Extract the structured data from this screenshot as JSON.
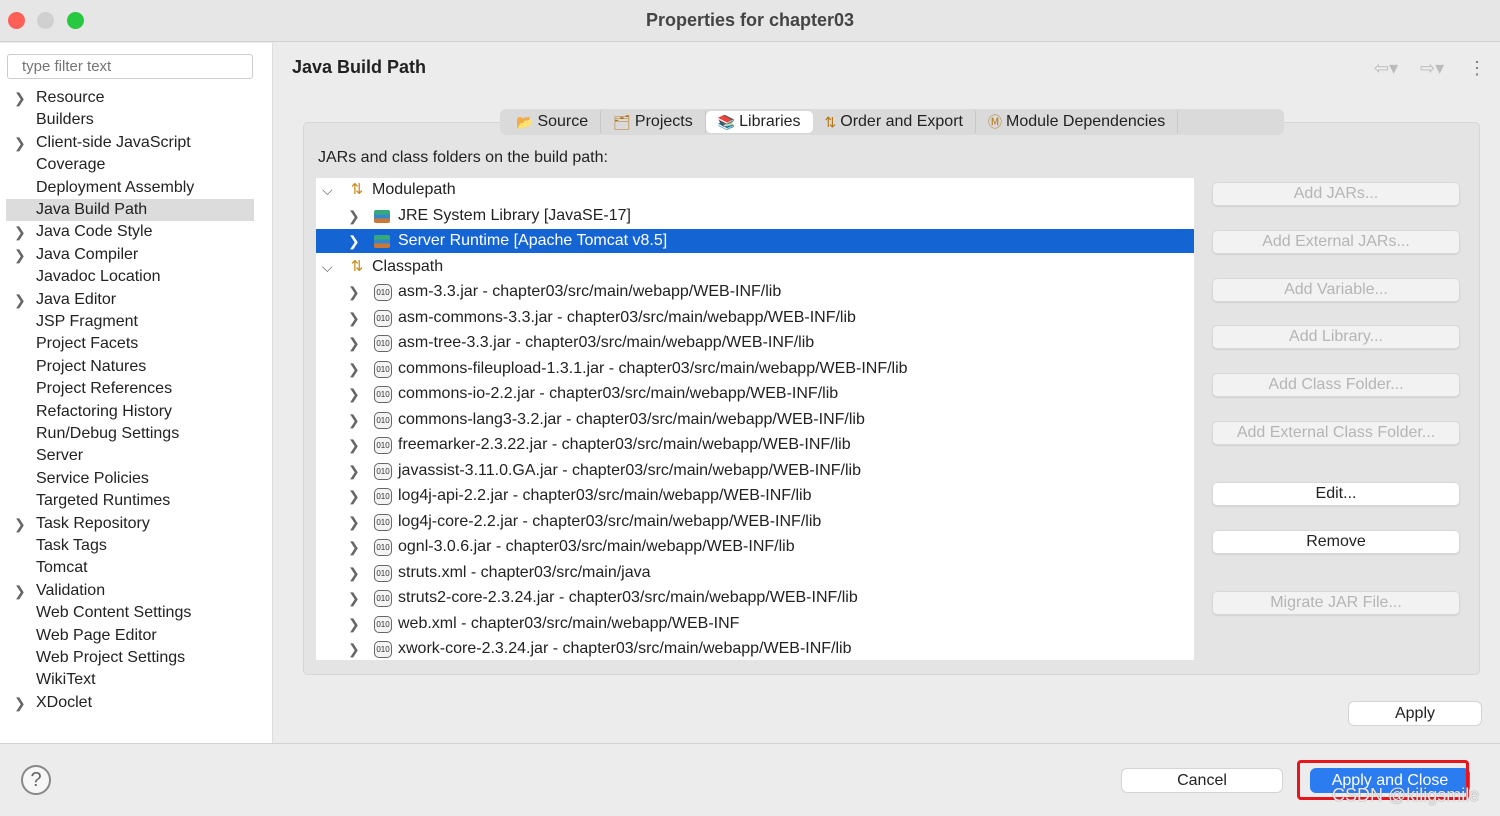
{
  "window": {
    "title": "Properties for chapter03"
  },
  "sidebar": {
    "filter_placeholder": "type filter text",
    "items": [
      {
        "label": "Resource",
        "expandable": true
      },
      {
        "label": "Builders"
      },
      {
        "label": "Client-side JavaScript",
        "expandable": true
      },
      {
        "label": "Coverage"
      },
      {
        "label": "Deployment Assembly"
      },
      {
        "label": "Java Build Path",
        "selected": true
      },
      {
        "label": "Java Code Style",
        "expandable": true
      },
      {
        "label": "Java Compiler",
        "expandable": true
      },
      {
        "label": "Javadoc Location"
      },
      {
        "label": "Java Editor",
        "expandable": true
      },
      {
        "label": "JSP Fragment"
      },
      {
        "label": "Project Facets"
      },
      {
        "label": "Project Natures"
      },
      {
        "label": "Project References"
      },
      {
        "label": "Refactoring History"
      },
      {
        "label": "Run/Debug Settings"
      },
      {
        "label": "Server"
      },
      {
        "label": "Service Policies"
      },
      {
        "label": "Targeted Runtimes"
      },
      {
        "label": "Task Repository",
        "expandable": true
      },
      {
        "label": "Task Tags"
      },
      {
        "label": "Tomcat"
      },
      {
        "label": "Validation",
        "expandable": true
      },
      {
        "label": "Web Content Settings"
      },
      {
        "label": "Web Page Editor"
      },
      {
        "label": "Web Project Settings"
      },
      {
        "label": "WikiText"
      },
      {
        "label": "XDoclet",
        "expandable": true
      }
    ]
  },
  "main": {
    "title": "Java Build Path",
    "tabs": [
      {
        "label": "Source",
        "icon": "source-folder-icon"
      },
      {
        "label": "Projects",
        "icon": "projects-folder-icon"
      },
      {
        "label": "Libraries",
        "icon": "libraries-icon",
        "active": true
      },
      {
        "label": "Order and Export",
        "icon": "order-arrows-icon"
      },
      {
        "label": "Module Dependencies",
        "icon": "module-icon"
      }
    ],
    "tree_label": "JARs and class folders on the build path:",
    "tree": [
      {
        "level": 0,
        "label": "Modulepath",
        "icon": "modulepath-icon",
        "expanded": true
      },
      {
        "level": 1,
        "label": "JRE System Library [JavaSE-17]",
        "icon": "library-icon"
      },
      {
        "level": 1,
        "label": "Server Runtime [Apache Tomcat v8.5]",
        "icon": "library-icon",
        "selected": true
      },
      {
        "level": 0,
        "label": "Classpath",
        "icon": "classpath-icon",
        "expanded": true
      },
      {
        "level": 1,
        "label": "asm-3.3.jar - chapter03/src/main/webapp/WEB-INF/lib",
        "icon": "jar-icon"
      },
      {
        "level": 1,
        "label": "asm-commons-3.3.jar - chapter03/src/main/webapp/WEB-INF/lib",
        "icon": "jar-icon"
      },
      {
        "level": 1,
        "label": "asm-tree-3.3.jar - chapter03/src/main/webapp/WEB-INF/lib",
        "icon": "jar-icon"
      },
      {
        "level": 1,
        "label": "commons-fileupload-1.3.1.jar - chapter03/src/main/webapp/WEB-INF/lib",
        "icon": "jar-icon"
      },
      {
        "level": 1,
        "label": "commons-io-2.2.jar - chapter03/src/main/webapp/WEB-INF/lib",
        "icon": "jar-icon"
      },
      {
        "level": 1,
        "label": "commons-lang3-3.2.jar - chapter03/src/main/webapp/WEB-INF/lib",
        "icon": "jar-icon"
      },
      {
        "level": 1,
        "label": "freemarker-2.3.22.jar - chapter03/src/main/webapp/WEB-INF/lib",
        "icon": "jar-icon"
      },
      {
        "level": 1,
        "label": "javassist-3.11.0.GA.jar - chapter03/src/main/webapp/WEB-INF/lib",
        "icon": "jar-icon"
      },
      {
        "level": 1,
        "label": "log4j-api-2.2.jar - chapter03/src/main/webapp/WEB-INF/lib",
        "icon": "jar-icon"
      },
      {
        "level": 1,
        "label": "log4j-core-2.2.jar - chapter03/src/main/webapp/WEB-INF/lib",
        "icon": "jar-icon"
      },
      {
        "level": 1,
        "label": "ognl-3.0.6.jar - chapter03/src/main/webapp/WEB-INF/lib",
        "icon": "jar-icon"
      },
      {
        "level": 1,
        "label": "struts.xml - chapter03/src/main/java",
        "icon": "jar-icon"
      },
      {
        "level": 1,
        "label": "struts2-core-2.3.24.jar - chapter03/src/main/webapp/WEB-INF/lib",
        "icon": "jar-icon"
      },
      {
        "level": 1,
        "label": "web.xml - chapter03/src/main/webapp/WEB-INF",
        "icon": "jar-icon"
      },
      {
        "level": 1,
        "label": "xwork-core-2.3.24.jar - chapter03/src/main/webapp/WEB-INF/lib",
        "icon": "jar-icon"
      }
    ],
    "buttons": [
      {
        "label": "Add JARs...",
        "enabled": false
      },
      {
        "label": "Add External JARs...",
        "enabled": false
      },
      {
        "label": "Add Variable...",
        "enabled": false
      },
      {
        "label": "Add Library...",
        "enabled": false
      },
      {
        "label": "Add Class Folder...",
        "enabled": false
      },
      {
        "label": "Add External Class Folder...",
        "enabled": false
      },
      {
        "label": "Edit...",
        "enabled": true
      },
      {
        "label": "Remove",
        "enabled": true
      },
      {
        "label": "Migrate JAR File...",
        "enabled": false
      }
    ],
    "apply": "Apply"
  },
  "footer": {
    "cancel": "Cancel",
    "apply_close": "Apply and Close",
    "help_icon": "?"
  },
  "watermark": "CSDN @kiligsmile",
  "colors": {
    "selection": "#1464d4",
    "primary": "#2a7cf0",
    "highlight_box": "#e8141e"
  }
}
